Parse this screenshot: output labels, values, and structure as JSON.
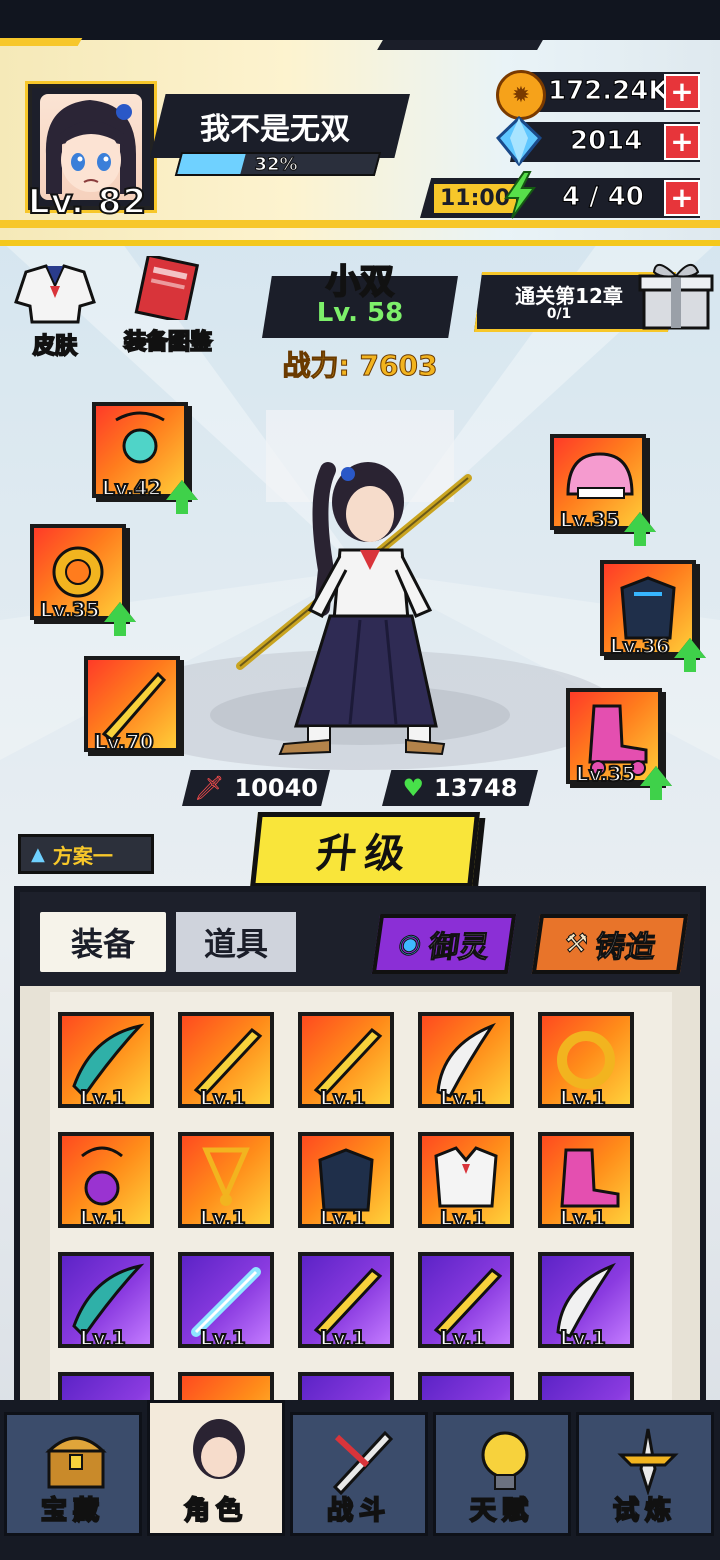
{
  "player": {
    "name": "我不是无双",
    "level_label": "Lv. 82",
    "exp_percent_label": "32%",
    "exp_fraction": 0.32
  },
  "resources": {
    "coins": "172.24K",
    "gems": "2014",
    "energy_timer": "11:00",
    "energy": "4 / 40"
  },
  "side_buttons": {
    "skin": "皮肤",
    "equipment_codex": "装备图鉴"
  },
  "character": {
    "name": "小双",
    "level_label": "Lv. 58",
    "power_label": "战力: 7603",
    "attack": "10040",
    "hp": "13748"
  },
  "chapter_reward": {
    "title": "通关第12章",
    "progress": "0/1"
  },
  "equipped": [
    {
      "name": "necklace",
      "level": "Lv.42",
      "upgradable": true
    },
    {
      "name": "ring",
      "level": "Lv.35",
      "upgradable": true
    },
    {
      "name": "sword",
      "level": "Lv.70",
      "upgradable": false
    },
    {
      "name": "helmet",
      "level": "Lv.35",
      "upgradable": true
    },
    {
      "name": "armor",
      "level": "Lv.36",
      "upgradable": true
    },
    {
      "name": "shoes",
      "level": "Lv.35",
      "upgradable": true
    }
  ],
  "upgrade_label": "升级",
  "plan_label": "方案一",
  "tabs": {
    "equipment": "装备",
    "items": "道具",
    "spirit": "御灵",
    "forge": "铸造"
  },
  "inventory": [
    {
      "item": "scythe",
      "rarity": "orange",
      "level": "Lv.1"
    },
    {
      "item": "sword",
      "rarity": "orange",
      "level": "Lv.1"
    },
    {
      "item": "sword",
      "rarity": "orange",
      "level": "Lv.1"
    },
    {
      "item": "blade",
      "rarity": "orange",
      "level": "Lv.1"
    },
    {
      "item": "ring",
      "rarity": "orange",
      "level": "Lv.1"
    },
    {
      "item": "necklace",
      "rarity": "orange",
      "level": "Lv.1"
    },
    {
      "item": "pendant",
      "rarity": "orange",
      "level": "Lv.1"
    },
    {
      "item": "armor",
      "rarity": "orange",
      "level": "Lv.1"
    },
    {
      "item": "uniform",
      "rarity": "orange",
      "level": "Lv.1"
    },
    {
      "item": "skates",
      "rarity": "orange",
      "level": "Lv.1"
    },
    {
      "item": "scythe",
      "rarity": "purple",
      "level": "Lv.1"
    },
    {
      "item": "lightsaber",
      "rarity": "purple",
      "level": "Lv.1"
    },
    {
      "item": "sword",
      "rarity": "purple",
      "level": "Lv.1"
    },
    {
      "item": "sword",
      "rarity": "purple",
      "level": "Lv.1"
    },
    {
      "item": "blade",
      "rarity": "purple",
      "level": "Lv.1"
    }
  ],
  "nav": [
    {
      "label": "宝藏",
      "icon": "treasure-chest-icon",
      "active": false
    },
    {
      "label": "角色",
      "icon": "character-icon",
      "active": true
    },
    {
      "label": "战斗",
      "icon": "battle-icon",
      "active": false
    },
    {
      "label": "天赋",
      "icon": "talent-bulb-icon",
      "active": false
    },
    {
      "label": "试炼",
      "icon": "trial-sword-icon",
      "active": false
    }
  ],
  "colors": {
    "accent_yellow": "#f7c72a",
    "exp_blue": "#6fd1ff",
    "power_gold": "#f2b41f",
    "level_green": "#7df06a",
    "orange_rarity": "#ff8d1a",
    "purple_rarity": "#8a3be0"
  }
}
